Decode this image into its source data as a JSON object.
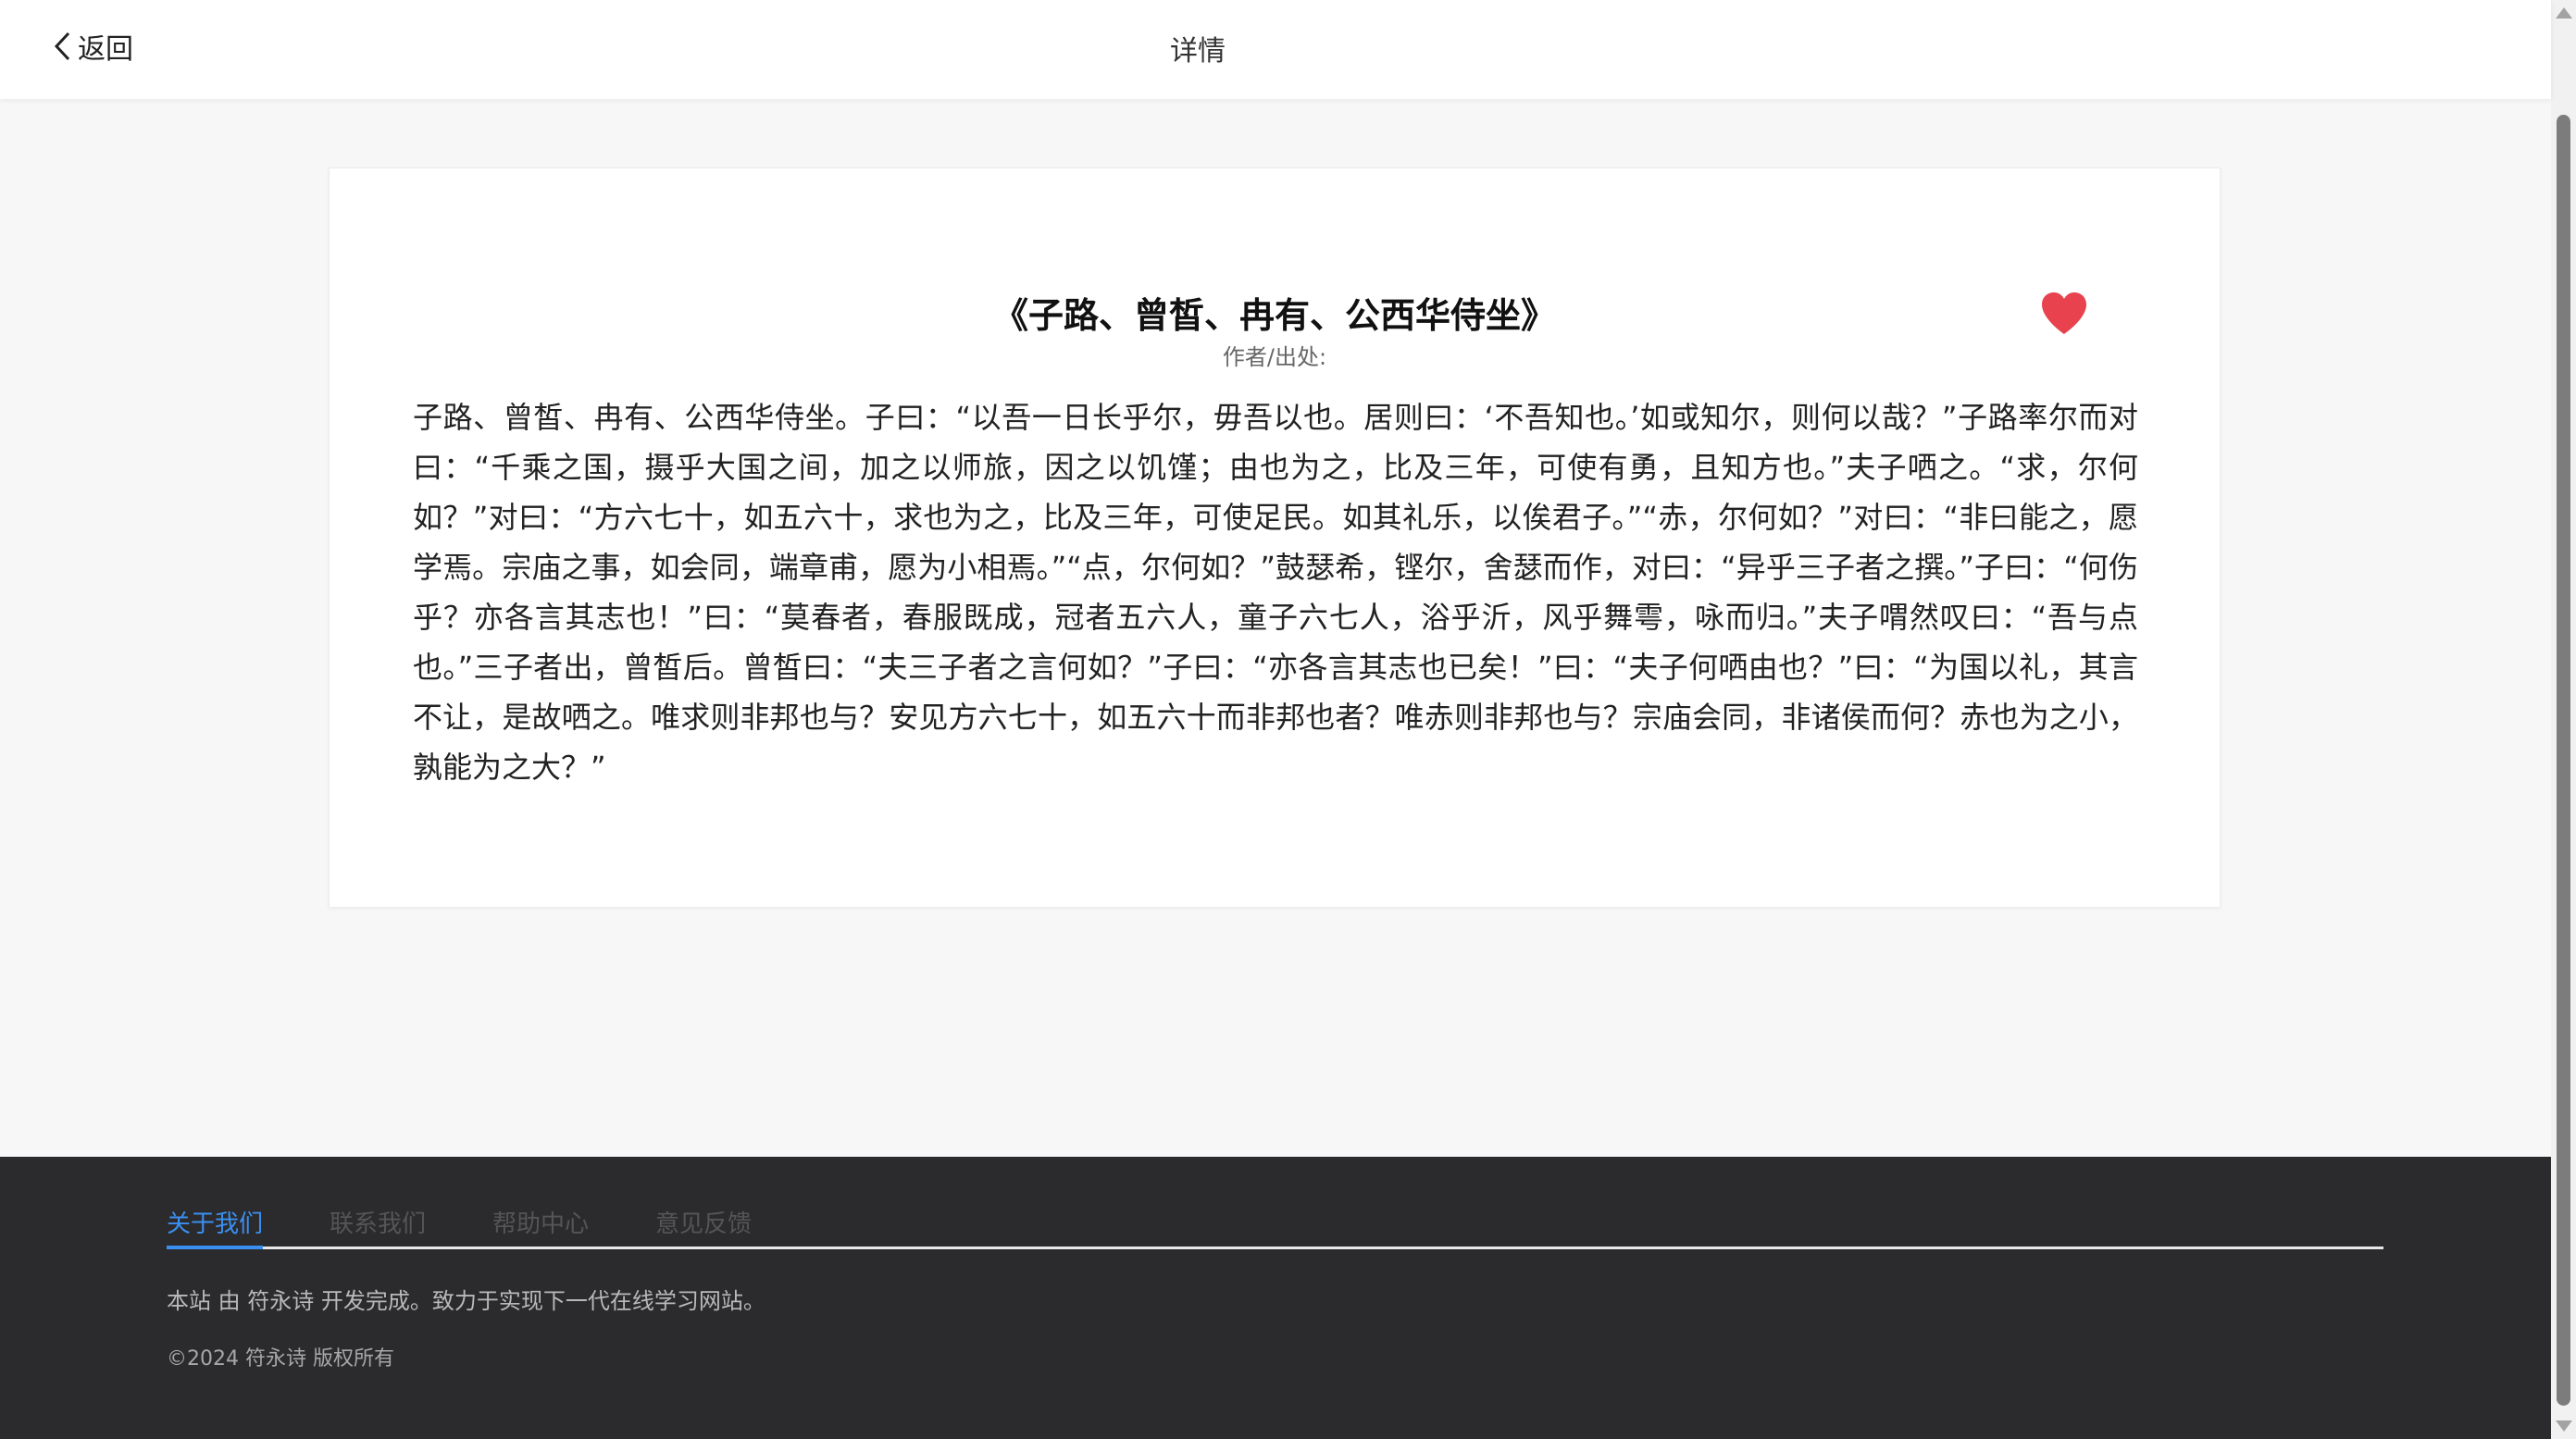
{
  "header": {
    "back_label": "返回",
    "title": "详情"
  },
  "poem": {
    "title": "《子路、曾皙、冉有、公西华侍坐》",
    "author_label": "作者/出处:",
    "content": "子路、曾皙、冉有、公西华侍坐。子曰：“以吾一日长乎尔，毋吾以也。居则曰：‘不吾知也。’如或知尔，则何以哉？”子路率尔而对曰：“千乘之国，摄乎大国之间，加之以师旅，因之以饥馑；由也为之，比及三年，可使有勇，且知方也。”夫子哂之。“求，尔何如？”对曰：“方六七十，如五六十，求也为之，比及三年，可使足民。如其礼乐，以俟君子。”“赤，尔何如？”对曰：“非曰能之，愿学焉。宗庙之事，如会同，端章甫，愿为小相焉。”“点，尔何如？”鼓瑟希，铿尔，舍瑟而作，对曰：“异乎三子者之撰。”子曰：“何伤乎？亦各言其志也！”曰：“莫春者，春服既成，冠者五六人，童子六七人，浴乎沂，风乎舞雩，咏而归。”夫子喟然叹曰：“吾与点也。”三子者出，曾皙后。曾皙曰：“夫三子者之言何如？”子曰：“亦各言其志也已矣！”曰：“夫子何哂由也？”曰：“为国以礼，其言不让，是故哂之。唯求则非邦也与？安见方六七十，如五六十而非邦也者？唯赤则非邦也与？宗庙会同，非诸侯而何？赤也为之小，孰能为之大？”",
    "favorite_icon": "heart-icon",
    "favorite_color": "#e8424f"
  },
  "footer": {
    "tabs": [
      {
        "label": "关于我们"
      },
      {
        "label": "联系我们"
      },
      {
        "label": "帮助中心"
      },
      {
        "label": "意见反馈"
      }
    ],
    "active_tab_color": "#3b8ff0",
    "description": "本站 由 符永诗 开发完成。致力于实现下一代在线学习网站。",
    "copyright": "©2024 符永诗 版权所有"
  }
}
